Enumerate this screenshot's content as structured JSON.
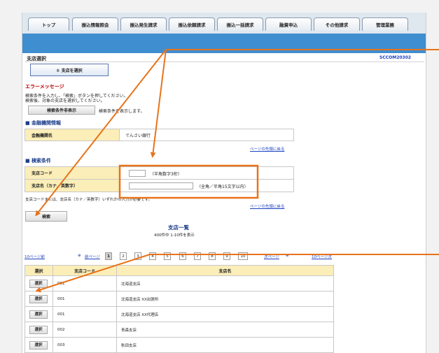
{
  "tabs": [
    "トップ",
    "振込情報照会",
    "振込発生請求",
    "振込依頼請求",
    "振込一括請求",
    "融資申込",
    "その他請求",
    "管理業務"
  ],
  "screen": {
    "title": "支店選択",
    "code": "SCCOM20302"
  },
  "step_button": "① 支店を選択",
  "error": {
    "heading": "エラーメッセージ",
    "line1": "検索条件を入力し、「検索」ボタンを押してください。",
    "line2": "検索後、対象の支店を選択してください。"
  },
  "search_condition": {
    "button": "検索条件非表示",
    "note": "検索条件を表示します。"
  },
  "financial": {
    "heading": "■ 金融機関情報",
    "label": "金融機関名",
    "value": "でんさい銀行",
    "top_link": "ページの先頭に戻る"
  },
  "criteria": {
    "heading": "■ 検索条件",
    "branch_code_label": "支店コード",
    "branch_code_hint": "（半角数字3桁）",
    "branch_name_label": "支店名（カナ／英数字）",
    "branch_name_hint": "（全角／半角15文字以内）",
    "note": "支店コードまたは、支店名（カナ／英数字）いずれかの入力が必要です。",
    "top_link": "ページの先頭に戻る"
  },
  "search_button": "検索",
  "results": {
    "title": "支店一覧",
    "count": "400件中 1-10件を表示",
    "prev10": "10ページ前",
    "prev": "前ページ",
    "next": "次ページ",
    "next10": "10ページ次",
    "pages": [
      "1",
      "2",
      "3",
      "4",
      "5",
      "6",
      "7",
      "8",
      "9",
      "10"
    ],
    "current_page": "1",
    "headers": [
      "選択",
      "支店コード",
      "支店名"
    ],
    "select_label": "選択",
    "rows": [
      {
        "code": "001",
        "name": "北海道支店"
      },
      {
        "code": "001",
        "name": "北海道支店 XX出張所"
      },
      {
        "code": "001",
        "name": "北海道支店 XX代理店"
      },
      {
        "code": "002",
        "name": "青森支店"
      },
      {
        "code": "003",
        "name": "秋田支店"
      }
    ]
  },
  "colors": {
    "accent_banner": "#3f8ed0",
    "callout": "#e8731a",
    "table_header": "#fbeeb8",
    "error": "#c00000",
    "link": "#1a40c0"
  }
}
